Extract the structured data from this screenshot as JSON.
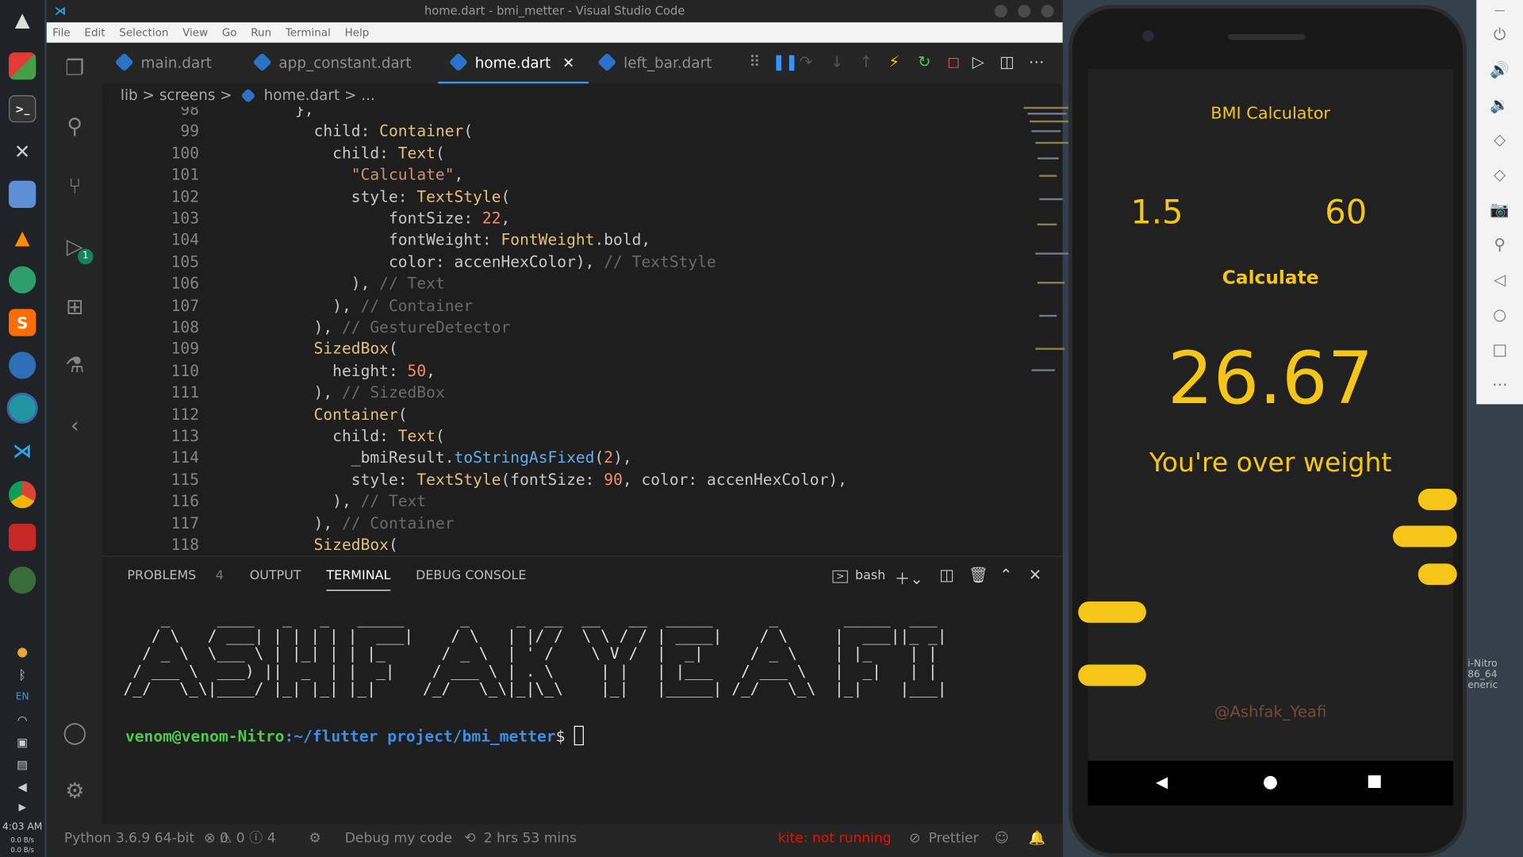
{
  "window": {
    "title": "home.dart - bmi_metter - Visual Studio Code"
  },
  "menu": [
    "File",
    "Edit",
    "Selection",
    "View",
    "Go",
    "Run",
    "Terminal",
    "Help"
  ],
  "tabs": [
    {
      "label": "main.dart"
    },
    {
      "label": "app_constant.dart"
    },
    {
      "label": "home.dart"
    },
    {
      "label": "left_bar.dart"
    }
  ],
  "breadcrumb": {
    "part1": "lib",
    "part2": "screens",
    "part3": "home.dart",
    "part4": "...",
    "sep": ">"
  },
  "code": [
    {
      "n": "98",
      "t": [
        [
          "p",
          "      },"
        ]
      ]
    },
    {
      "n": "99",
      "t": [
        [
          "p",
          "        child: "
        ],
        [
          "y",
          "Container"
        ],
        [
          "p",
          "("
        ]
      ]
    },
    {
      "n": "100",
      "t": [
        [
          "p",
          "          child: "
        ],
        [
          "y",
          "Text"
        ],
        [
          "p",
          "("
        ]
      ]
    },
    {
      "n": "101",
      "t": [
        [
          "s",
          "            \"Calculate\""
        ],
        [
          "p",
          ","
        ]
      ]
    },
    {
      "n": "102",
      "t": [
        [
          "p",
          "            style: "
        ],
        [
          "y",
          "TextStyle"
        ],
        [
          "p",
          "("
        ]
      ]
    },
    {
      "n": "103",
      "t": [
        [
          "p",
          "                fontSize: "
        ],
        [
          "n",
          "22"
        ],
        [
          "p",
          ","
        ]
      ]
    },
    {
      "n": "104",
      "t": [
        [
          "p",
          "                fontWeight: "
        ],
        [
          "y",
          "FontWeight"
        ],
        [
          "p",
          ".bold,"
        ]
      ]
    },
    {
      "n": "105",
      "t": [
        [
          "p",
          "                color: accenHexColor), "
        ],
        [
          "c",
          "// TextStyle"
        ]
      ]
    },
    {
      "n": "106",
      "t": [
        [
          "p",
          "            ), "
        ],
        [
          "c",
          "// Text"
        ]
      ]
    },
    {
      "n": "107",
      "t": [
        [
          "p",
          "          ), "
        ],
        [
          "c",
          "// Container"
        ]
      ]
    },
    {
      "n": "108",
      "t": [
        [
          "p",
          "        ), "
        ],
        [
          "c",
          "// GestureDetector"
        ]
      ]
    },
    {
      "n": "109",
      "t": [
        [
          "y",
          "        SizedBox"
        ],
        [
          "p",
          "("
        ]
      ]
    },
    {
      "n": "110",
      "t": [
        [
          "p",
          "          height: "
        ],
        [
          "n",
          "50"
        ],
        [
          "p",
          ","
        ]
      ]
    },
    {
      "n": "111",
      "t": [
        [
          "p",
          "        ), "
        ],
        [
          "c",
          "// SizedBox"
        ]
      ]
    },
    {
      "n": "112",
      "t": [
        [
          "y",
          "        Container"
        ],
        [
          "p",
          "("
        ]
      ]
    },
    {
      "n": "113",
      "t": [
        [
          "p",
          "          child: "
        ],
        [
          "y",
          "Text"
        ],
        [
          "p",
          "("
        ]
      ]
    },
    {
      "n": "114",
      "t": [
        [
          "p",
          "            _bmiResult."
        ],
        [
          "f",
          "toStringAsFixed"
        ],
        [
          "p",
          "("
        ],
        [
          "n",
          "2"
        ],
        [
          "p",
          "),"
        ]
      ]
    },
    {
      "n": "115",
      "t": [
        [
          "p",
          "            style: "
        ],
        [
          "y",
          "TextStyle"
        ],
        [
          "p",
          "(fontSize: "
        ],
        [
          "n",
          "90"
        ],
        [
          "p",
          ", color: accenHexColor),"
        ]
      ]
    },
    {
      "n": "116",
      "t": [
        [
          "p",
          "          ), "
        ],
        [
          "c",
          "// Text"
        ]
      ]
    },
    {
      "n": "117",
      "t": [
        [
          "p",
          "        ), "
        ],
        [
          "c",
          "// Container"
        ]
      ]
    },
    {
      "n": "118",
      "t": [
        [
          "y",
          "        SizedBox"
        ],
        [
          "p",
          "("
        ]
      ]
    }
  ],
  "panel": {
    "tabs": [
      "PROBLEMS",
      "OUTPUT",
      "TERMINAL",
      "DEBUG CONSOLE"
    ],
    "problems_count": "4",
    "shell": "bash"
  },
  "terminal": {
    "ascii": "    _     ____   _   _   _____      _     _  __  __   __  _____      _       _____  ___ \n   / \\   / ___| | | | | |  ___|    / \\   | |/ /  \\ \\ / / | ____|    / \\     |  ___||_ _|\n  / _ \\  \\___ \\ | |_| | | |_      / _ \\  | ' /    \\ V /  |  _|     / _ \\    | |_    | | \n / ___ \\  ___) ||  _  | |  _|    / ___ \\ | . \\     | |   | |___   / ___ \\   |  _|   | | \n/_/   \\_\\|____/ |_| |_| |_|     /_/   \\_\\|_|\\_\\    |_|   |_____| /_/   \\_\\  |_|    |___|",
    "user": "venom@venom-Nitro",
    "path": ":~/flutter project/bmi_metter",
    "symbol": "$ "
  },
  "status": {
    "python": "Python 3.6.9 64-bit",
    "errors": "0",
    "warnings": "0",
    "infos": "4",
    "debug": "Debug my code",
    "time": "2 hrs 53 mins",
    "kite": "kite: not running",
    "prettier": "Prettier"
  },
  "clock": {
    "time": "4:03 AM",
    "net_up": "0.0 B/s",
    "net_down": "0.0 B/s",
    "lang": "EN"
  },
  "phone": {
    "app_title": "BMI Calculator",
    "height": "1.5",
    "weight": "60",
    "button": "Calculate",
    "result": "26.67",
    "message": "You're over weight",
    "credit": "@Ashfak_Yeafi"
  },
  "background_text": {
    "l1": "i-Nitro",
    "l2": "86_64",
    "l3": "eneric"
  },
  "colors": {
    "accent": "#f5c518",
    "app_bg": "#212121",
    "editor_bg": "#1e1e1e",
    "kite": "#e51400"
  }
}
